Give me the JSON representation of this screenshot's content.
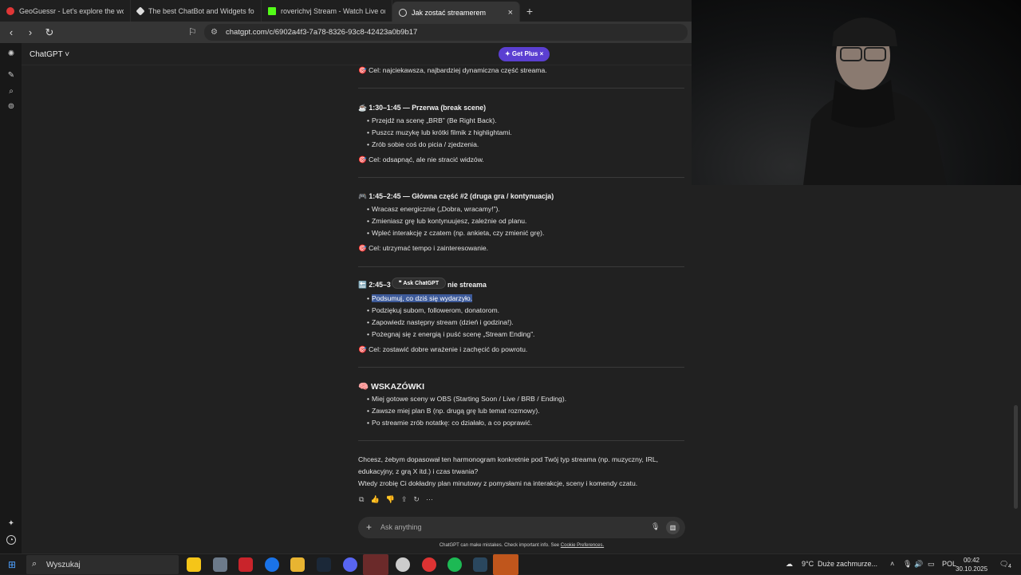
{
  "tabs": [
    {
      "title": "GeoGuessr - Let's explore the world!",
      "color": "#e03636"
    },
    {
      "title": "The best ChatBot and Widgets for Ki",
      "color": "#dddddd"
    },
    {
      "title": "roverichvj Stream - Watch Live on Ki",
      "color": "#53fc18"
    },
    {
      "title": "Jak zostać streamerem",
      "color": "#dddddd"
    }
  ],
  "tab_close": "×",
  "new_tab": "+",
  "url": "chatgpt.com/c/6902a4f3-7a78-8326-93c8-42423a0b9b17",
  "header": {
    "model": "ChatGPT ˅",
    "get_plus": "✦ Get Plus ×"
  },
  "content": {
    "goal1": "🎯 Cel: najciekawsza, najbardziej dynamiczna część streama.",
    "s2_title": "☕ 1:30–1:45 — Przerwa (break scene)",
    "s2_items": [
      "Przejdź na scenę „BRB” (Be Right Back).",
      "Puszcz muzykę lub krótki filmik z highlightami.",
      "Zrób sobie coś do picia / zjedzenia."
    ],
    "goal2": "🎯 Cel: odsapnąć, ale nie stracić widzów.",
    "s3_title": "🎮 1:45–2:45 — Główna część #2 (druga gra / kontynuacja)",
    "s3_items": [
      "Wracasz energicznie („Dobra, wracamy!”).",
      "Zmieniasz grę lub kontynuujesz, zależnie od planu.",
      "Wpleć interakcję z czatem (np. ankieta, czy zmienić grę)."
    ],
    "goal3": "🎯 Cel: utrzymać tempo i zainteresowanie.",
    "s4_title_a": "🔚 2:45–3",
    "s4_title_b": "nie streama",
    "tooltip": "❞ Ask ChatGPT",
    "s4_selected": "Podsumuj, co dziś się wydarzyło.",
    "s4_items": [
      "Podziękuj subom, followerom, donatorom.",
      "Zapowiedz następny stream (dzień i godzina!).",
      "Pożegnaj się z energią i puść scenę „Stream Ending”."
    ],
    "goal4": "🎯 Cel: zostawić dobre wrażenie i zachęcić do powrotu.",
    "tips_title": "🧠 WSKAZÓWKI",
    "tips": [
      "Miej gotowe sceny w OBS (Starting Soon / Live / BRB / Ending).",
      "Zawsze miej plan B (np. drugą grę lub temat rozmowy).",
      "Po streamie zrób notatkę: co działało, a co poprawić."
    ],
    "closing1": "Chcesz, żebym dopasował ten harmonogram konkretnie pod Twój typ streama (np. muzyczny, IRL,",
    "closing2": "edukacyjny, z grą X itd.) i czas trwania?",
    "closing3": "Wtedy zrobię Ci dokładny plan minutowy z pomysłami na interakcje, sceny i komendy czatu."
  },
  "actions": [
    "⧉",
    "👍",
    "👎",
    "⇪",
    "↻",
    "⋯"
  ],
  "composer": {
    "placeholder": "Ask anything",
    "plus": "+",
    "mic": "🎙",
    "voice": "▥"
  },
  "disclaimer": "ChatGPT can make mistakes. Check important info. See",
  "disclaimer_link": "Cookie Preferences.",
  "taskbar": {
    "search": "Wyszukaj",
    "temp": "9°C",
    "weather": "Duże zachmurze...",
    "lang": "POL",
    "time": "00:42",
    "date": "30.10.2025",
    "notif": "4"
  }
}
